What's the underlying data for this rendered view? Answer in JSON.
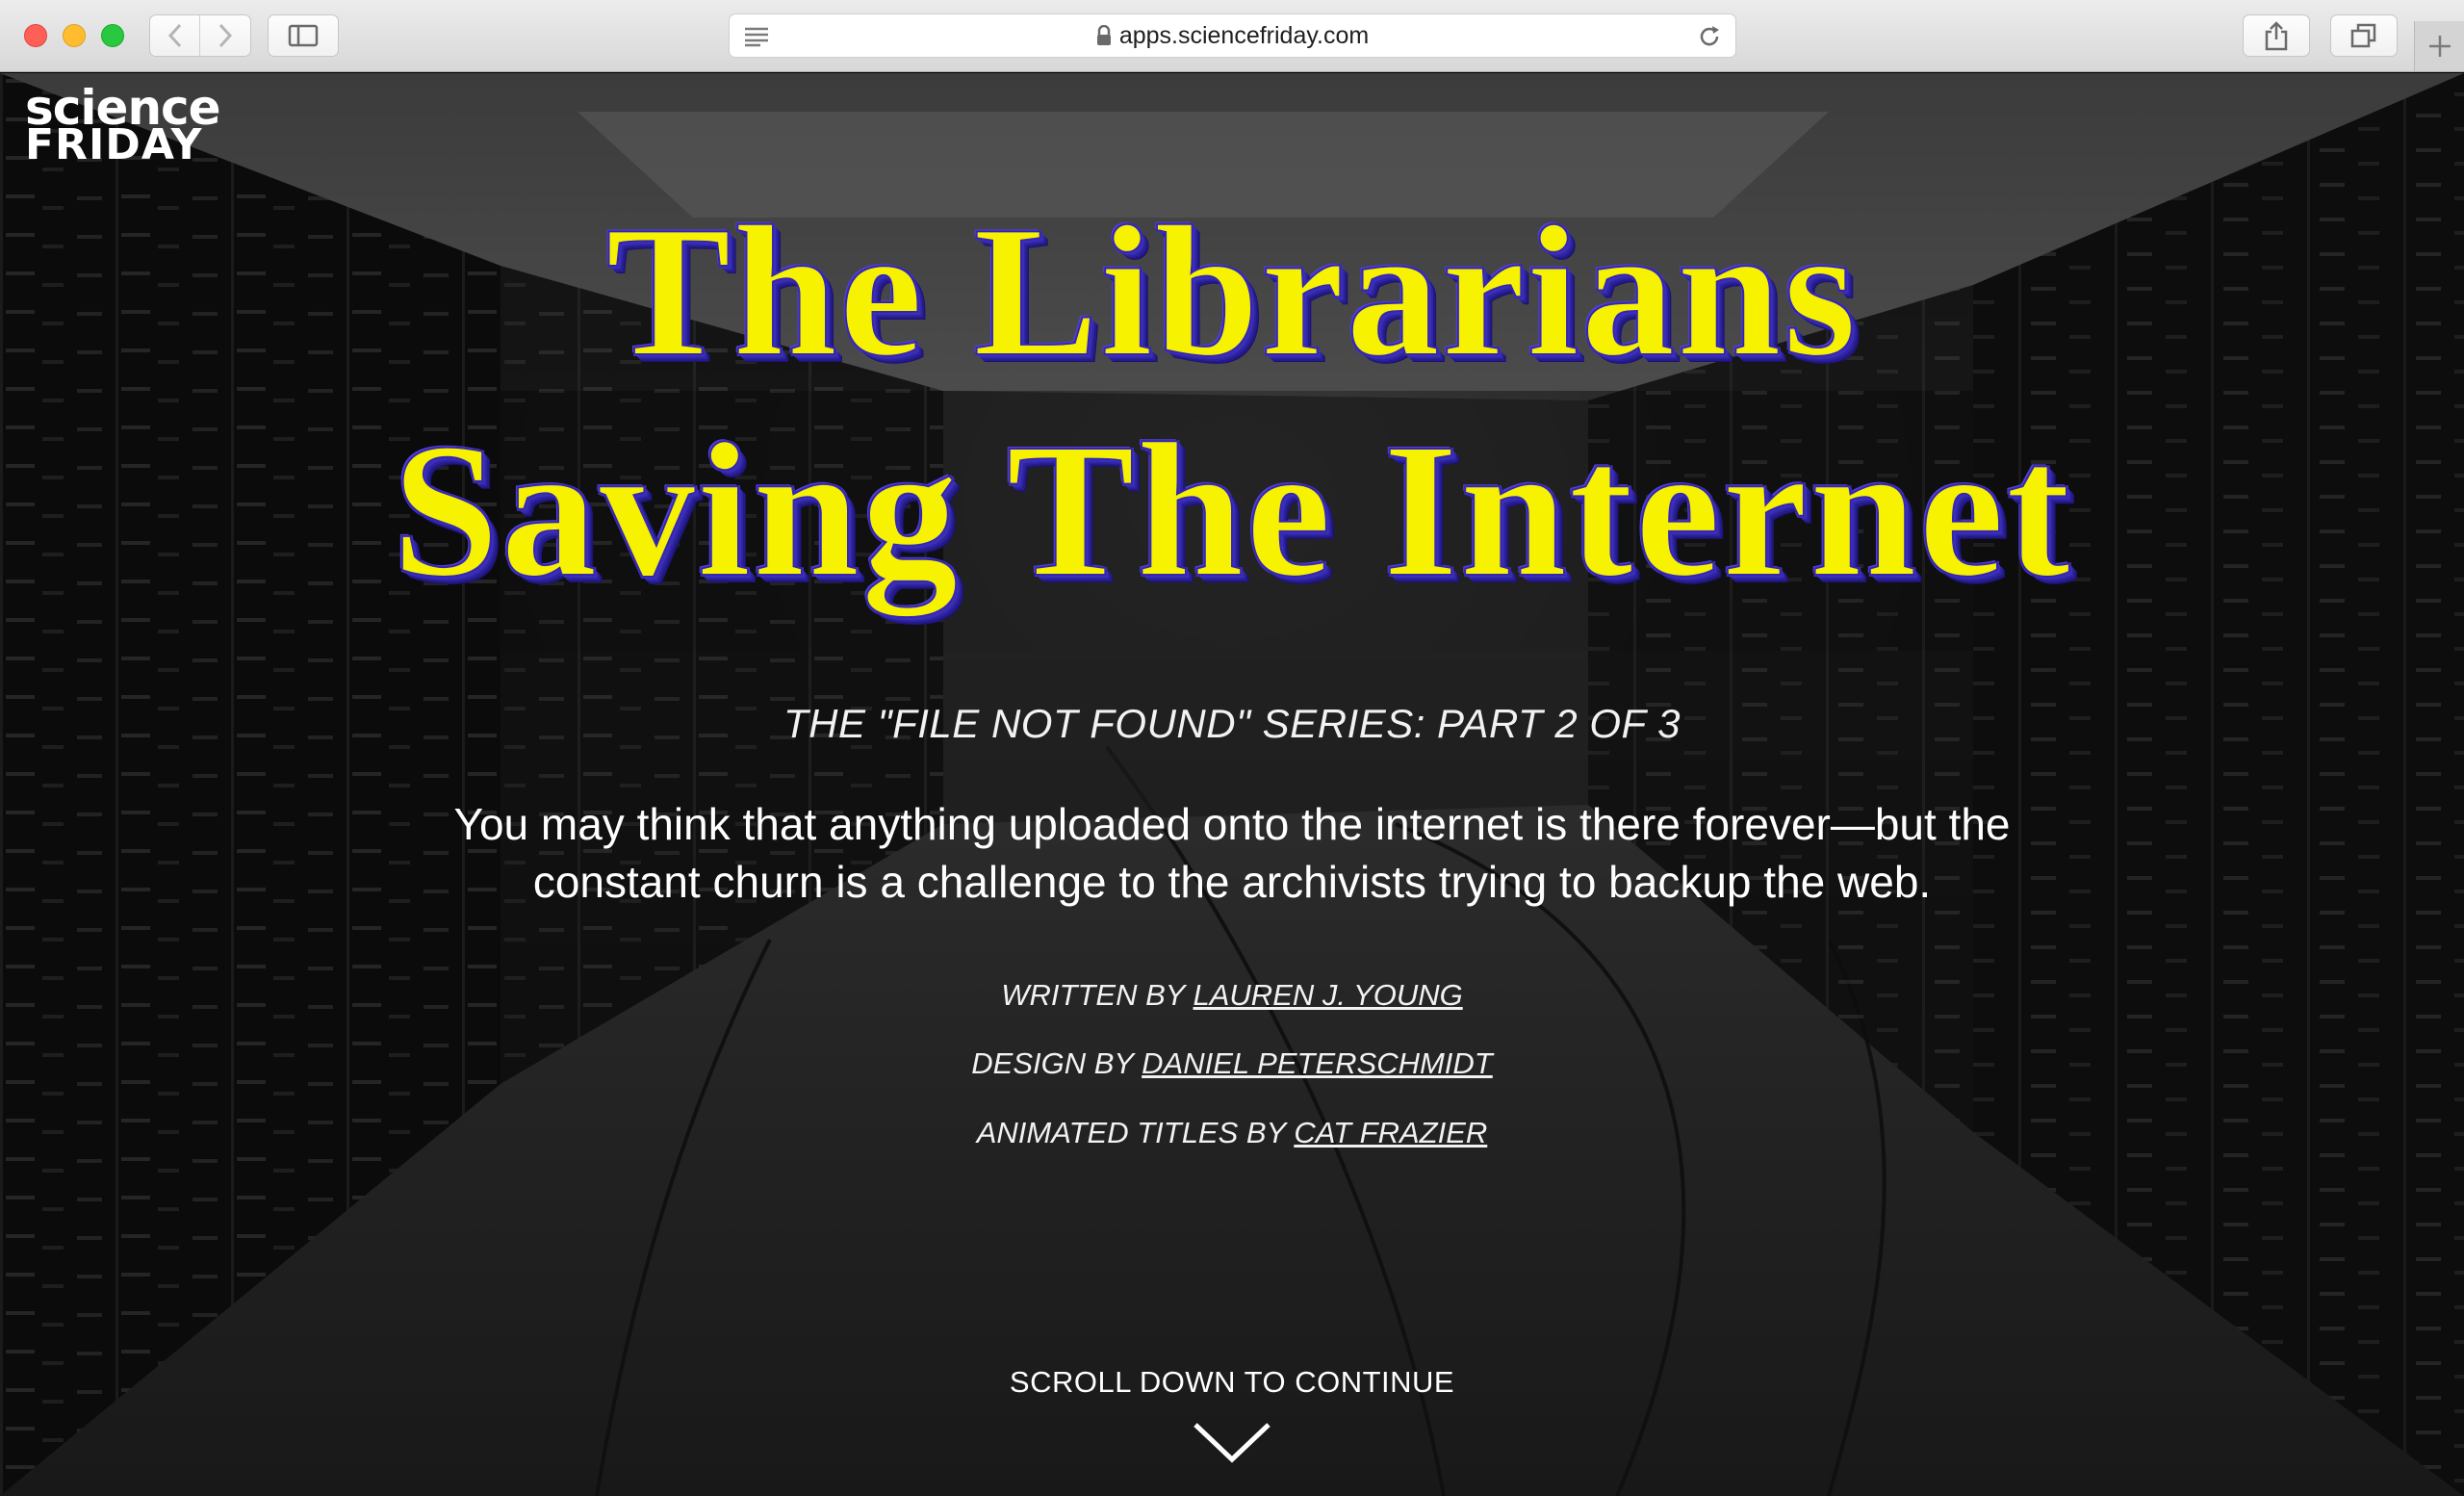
{
  "browser": {
    "url": "apps.sciencefriday.com",
    "icons": [
      "back-icon",
      "forward-icon",
      "sidebar-icon",
      "reader-icon",
      "lock-icon",
      "reload-icon",
      "share-icon",
      "tabs-icon",
      "plus-icon"
    ]
  },
  "site": {
    "logo_line1": "science",
    "logo_line2": "FRIDAY"
  },
  "hero": {
    "title_line1": "The Librarians",
    "title_line2": "Saving The Internet",
    "series": "THE \"FILE NOT FOUND\" SERIES: PART 2 OF 3",
    "dek": "You may think that anything uploaded onto the internet is there forever—but the constant churn is a challenge to the archivists trying to backup the web.",
    "credits": [
      {
        "label": "WRITTEN BY",
        "name": "LAUREN J. YOUNG"
      },
      {
        "label": "DESIGN BY",
        "name": "DANIEL PETERSCHMIDT"
      },
      {
        "label": "ANIMATED TITLES BY",
        "name": "CAT FRAZIER"
      }
    ],
    "scroll_prompt": "SCROLL DOWN TO CONTINUE"
  },
  "colors": {
    "title_fill": "#f6f200",
    "title_outline": "#3525b5"
  }
}
